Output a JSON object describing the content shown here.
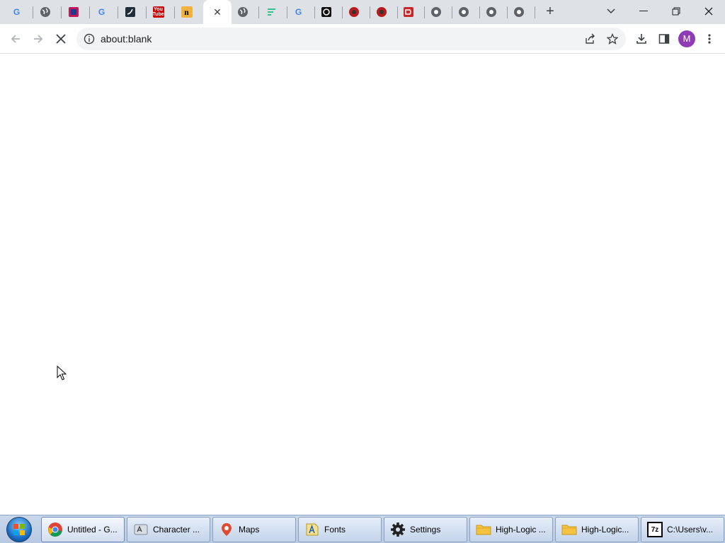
{
  "browser": {
    "address_url": "about:blank",
    "profile_initial": "M",
    "tab_favicons": [
      "google-icon",
      "globe-icon",
      "app-icon",
      "google-icon",
      "dark-app-icon",
      "youtube-icon",
      "n-logo-icon",
      "",
      "globe-icon",
      "stripes-icon",
      "google-icon",
      "ring-icon",
      "red-circle-icon",
      "red-circle-icon",
      "red-app-icon",
      "chrome-icon",
      "chrome-icon",
      "chrome-icon",
      "chrome-icon"
    ],
    "youtube_text": "You Tube",
    "n_text": "n"
  },
  "taskbar": {
    "items": [
      {
        "label": "Untitled - G...",
        "icon": "chrome-icon"
      },
      {
        "label": "Character ...",
        "icon": "charmap-icon"
      },
      {
        "label": "Maps",
        "icon": "maps-icon"
      },
      {
        "label": "Fonts",
        "icon": "fonts-icon"
      },
      {
        "label": "Settings",
        "icon": "gear-icon"
      },
      {
        "label": "High-Logic ...",
        "icon": "folder-icon"
      },
      {
        "label": "High-Logic...",
        "icon": "folder-icon"
      },
      {
        "label": "C:\\Users\\v...",
        "icon": "7zip-icon"
      }
    ],
    "sevenzip_text": "7z"
  },
  "colors": {
    "accent": "#1a73e8",
    "avatar": "#8e3bb5",
    "tabstrip": "#dee1e6"
  }
}
